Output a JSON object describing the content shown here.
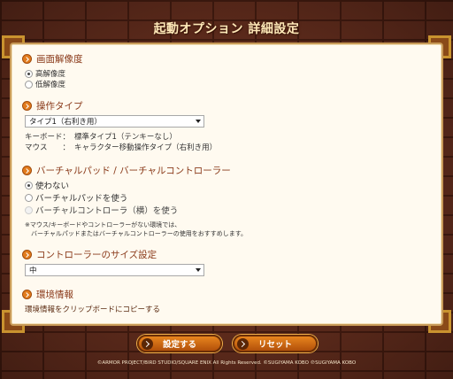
{
  "window": {
    "title": "起動オプション 詳細設定"
  },
  "resolution": {
    "heading": "画面解像度",
    "options": [
      {
        "label": "高解像度",
        "checked": true
      },
      {
        "label": "低解像度",
        "checked": false
      }
    ]
  },
  "operation": {
    "heading": "操作タイプ",
    "selected": "タイプ1（右利き用）",
    "keyboard_label": "キーボード：",
    "keyboard_value": "標準タイプ1（テンキーなし）",
    "mouse_label": "マウス　　：",
    "mouse_value": "キャラクター移動操作タイプ（右利き用）"
  },
  "virtual_pad": {
    "heading": "バーチャルパッド / バーチャルコントローラー",
    "options": [
      {
        "label": "使わない",
        "checked": true,
        "disabled": false
      },
      {
        "label": "バーチャルパッドを使う",
        "checked": false,
        "disabled": false
      },
      {
        "label": "バーチャルコントローラ（横）を使う",
        "checked": false,
        "disabled": true
      }
    ],
    "note_line1": "※マウス/キーボードやコントローラーがない環境では、",
    "note_line2": "　バーチャルパッドまたはバーチャルコントローラーの使用をおすすめします。"
  },
  "controller_size": {
    "heading": "コントローラーのサイズ設定",
    "selected": "中"
  },
  "environment": {
    "heading": "環境情報",
    "copy_link": "環境情報をクリップボードにコピーする"
  },
  "buttons": {
    "set_label": "設定する",
    "reset_label": "リセット"
  },
  "copyright": "©ARMOR PROJECT/BIRD STUDIO/SQUARE ENIX All Rights Reserved. ©SUGIYAMA KOBO ℗SUGIYAMA KOBO",
  "colors": {
    "accent_orange": "#e27b1c",
    "heading_text": "#8a3a1a",
    "panel_bg": "#fffaf0",
    "button_top": "#e8851e",
    "button_bottom": "#b2500a"
  }
}
